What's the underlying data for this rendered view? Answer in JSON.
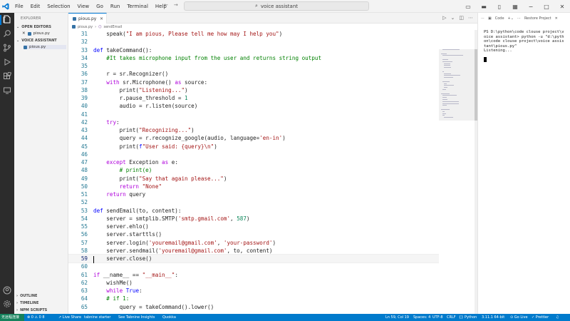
{
  "titlebar": {
    "menu": [
      "File",
      "Edit",
      "Selection",
      "View",
      "Go",
      "Run",
      "Terminal",
      "Help"
    ],
    "search": "voice assistant"
  },
  "sidebar": {
    "title": "EXPLORER",
    "open_editors": "OPEN EDITORS",
    "open_file": "pious.py",
    "project": "VOICE ASSISTANT",
    "project_file": "pious.py",
    "outline": "OUTLINE",
    "timeline": "TIMELINE",
    "npm": "NPM SCRIPTS"
  },
  "tab": {
    "label": "pious.py"
  },
  "breadcrumb": {
    "file": "pious.py",
    "symbol": "sendEmail"
  },
  "editor": {
    "lines": [
      {
        "n": "31",
        "indent": "    ",
        "tokens": [
          [
            "",
            "speak("
          ],
          [
            "str",
            "\"I am pious, Please tell me how may I help you\""
          ],
          [
            "",
            ")"
          ]
        ]
      },
      {
        "n": "32",
        "indent": "",
        "tokens": []
      },
      {
        "n": "33",
        "indent": "",
        "tokens": [
          [
            "kw",
            "def"
          ],
          [
            "",
            " takeCommand():"
          ]
        ]
      },
      {
        "n": "34",
        "indent": "    ",
        "tokens": [
          [
            "cmt",
            "#It takes microphone input from the user and returns string output"
          ]
        ]
      },
      {
        "n": "35",
        "indent": "",
        "tokens": []
      },
      {
        "n": "36",
        "indent": "    ",
        "tokens": [
          [
            "",
            "r = sr.Recognizer()"
          ]
        ]
      },
      {
        "n": "37",
        "indent": "    ",
        "tokens": [
          [
            "kw2",
            "with"
          ],
          [
            "",
            " sr.Microphone() "
          ],
          [
            "kw2",
            "as"
          ],
          [
            "",
            " source:"
          ]
        ]
      },
      {
        "n": "38",
        "indent": "        ",
        "tokens": [
          [
            "",
            "print("
          ],
          [
            "str",
            "\"Listening...\""
          ],
          [
            "",
            ")"
          ]
        ]
      },
      {
        "n": "39",
        "indent": "        ",
        "tokens": [
          [
            "",
            "r.pause_threshold = "
          ],
          [
            "num",
            "1"
          ]
        ]
      },
      {
        "n": "40",
        "indent": "        ",
        "tokens": [
          [
            "",
            "audio = r.listen(source)"
          ]
        ]
      },
      {
        "n": "41",
        "indent": "",
        "tokens": []
      },
      {
        "n": "42",
        "indent": "    ",
        "tokens": [
          [
            "kw2",
            "try"
          ],
          [
            "",
            ":"
          ]
        ]
      },
      {
        "n": "43",
        "indent": "        ",
        "tokens": [
          [
            "",
            "print("
          ],
          [
            "str",
            "\"Recognizing...\""
          ],
          [
            "",
            ")"
          ]
        ]
      },
      {
        "n": "44",
        "indent": "        ",
        "tokens": [
          [
            "",
            "query = r.recognize_google(audio, language="
          ],
          [
            "str",
            "'en-in'"
          ],
          [
            "",
            ")"
          ]
        ]
      },
      {
        "n": "45",
        "indent": "        ",
        "tokens": [
          [
            "",
            "print("
          ],
          [
            "kw",
            "f"
          ],
          [
            "str",
            "\"User said: {query}\\n\""
          ],
          [
            "",
            ")"
          ]
        ]
      },
      {
        "n": "46",
        "indent": "",
        "tokens": []
      },
      {
        "n": "47",
        "indent": "    ",
        "tokens": [
          [
            "kw2",
            "except"
          ],
          [
            "",
            " Exception "
          ],
          [
            "kw2",
            "as"
          ],
          [
            "",
            " e:"
          ]
        ]
      },
      {
        "n": "48",
        "indent": "        ",
        "tokens": [
          [
            "cmt",
            "# print(e)"
          ]
        ]
      },
      {
        "n": "49",
        "indent": "        ",
        "tokens": [
          [
            "",
            "print("
          ],
          [
            "str",
            "\"Say that again please...\""
          ],
          [
            "",
            ")"
          ]
        ]
      },
      {
        "n": "50",
        "indent": "        ",
        "tokens": [
          [
            "kw2",
            "return"
          ],
          [
            "",
            " "
          ],
          [
            "str",
            "\"None\""
          ]
        ]
      },
      {
        "n": "51",
        "indent": "    ",
        "tokens": [
          [
            "kw2",
            "return"
          ],
          [
            "",
            " query"
          ]
        ]
      },
      {
        "n": "52",
        "indent": "",
        "tokens": []
      },
      {
        "n": "53",
        "indent": "",
        "tokens": [
          [
            "kw",
            "def"
          ],
          [
            "",
            " sendEmail(to, content):"
          ]
        ]
      },
      {
        "n": "54",
        "indent": "    ",
        "tokens": [
          [
            "",
            "server = smtplib.SMTP("
          ],
          [
            "str",
            "'smtp.gmail.com'"
          ],
          [
            "",
            ", "
          ],
          [
            "num",
            "587"
          ],
          [
            "",
            ")"
          ]
        ]
      },
      {
        "n": "55",
        "indent": "    ",
        "tokens": [
          [
            "",
            "server.ehlo()"
          ]
        ]
      },
      {
        "n": "56",
        "indent": "    ",
        "tokens": [
          [
            "",
            "server.starttls()"
          ]
        ]
      },
      {
        "n": "57",
        "indent": "    ",
        "tokens": [
          [
            "",
            "server.login("
          ],
          [
            "str",
            "'youremail@gmail.com'"
          ],
          [
            "",
            ", "
          ],
          [
            "str",
            "'your-password'"
          ],
          [
            "",
            ")"
          ]
        ]
      },
      {
        "n": "58",
        "indent": "    ",
        "tokens": [
          [
            "",
            "server.sendmail("
          ],
          [
            "str",
            "'youremail@gmail.com'"
          ],
          [
            "",
            ", to, content)"
          ]
        ]
      },
      {
        "n": "59",
        "indent": "    ",
        "tokens": [
          [
            "",
            "server.close()"
          ]
        ],
        "current": true
      },
      {
        "n": "60",
        "indent": "",
        "tokens": []
      },
      {
        "n": "61",
        "indent": "",
        "tokens": [
          [
            "kw2",
            "if"
          ],
          [
            "",
            " __name__ == "
          ],
          [
            "str",
            "\"__main__\""
          ],
          [
            "",
            ":"
          ]
        ]
      },
      {
        "n": "62",
        "indent": "    ",
        "tokens": [
          [
            "",
            "wishMe()"
          ]
        ]
      },
      {
        "n": "63",
        "indent": "    ",
        "tokens": [
          [
            "kw2",
            "while"
          ],
          [
            "",
            " "
          ],
          [
            "kw",
            "True"
          ],
          [
            "",
            ":"
          ]
        ]
      },
      {
        "n": "64",
        "indent": "    ",
        "tokens": [
          [
            "cmt",
            "# if 1:"
          ]
        ]
      },
      {
        "n": "65",
        "indent": "        ",
        "tokens": [
          [
            "",
            "query = takeCommand().lower()"
          ]
        ]
      }
    ]
  },
  "terminal": {
    "toolbar_code": "Code",
    "toolbar_restore": "Restore Project",
    "text": "PS D:\\python\\code clouse project\\v\noice assistant> python -u \"d:\\pyth\non\\code clouse project\\voice assis\ntant\\pious.py\"\nListening..."
  },
  "statusbar": {
    "remote": "无远程连接",
    "problems": "⊗ 0 ⚠ 0  8",
    "live_share": "Live Share",
    "tabnine": "tabnine starter",
    "insights": "See Tabnine Insights",
    "quokka": "Quokka",
    "position": "Ln 59, Col 19",
    "spaces": "Spaces: 4",
    "encoding": "UTF-8",
    "eol": "CRLF",
    "language": "Python",
    "interpreter": "3.11.1 64-bit",
    "go_live": "Go Live",
    "prettier": "Prettier"
  },
  "colors": {
    "statusbar": "#007acc",
    "activity": "#2c2c2c",
    "accent": "#0078d4"
  }
}
